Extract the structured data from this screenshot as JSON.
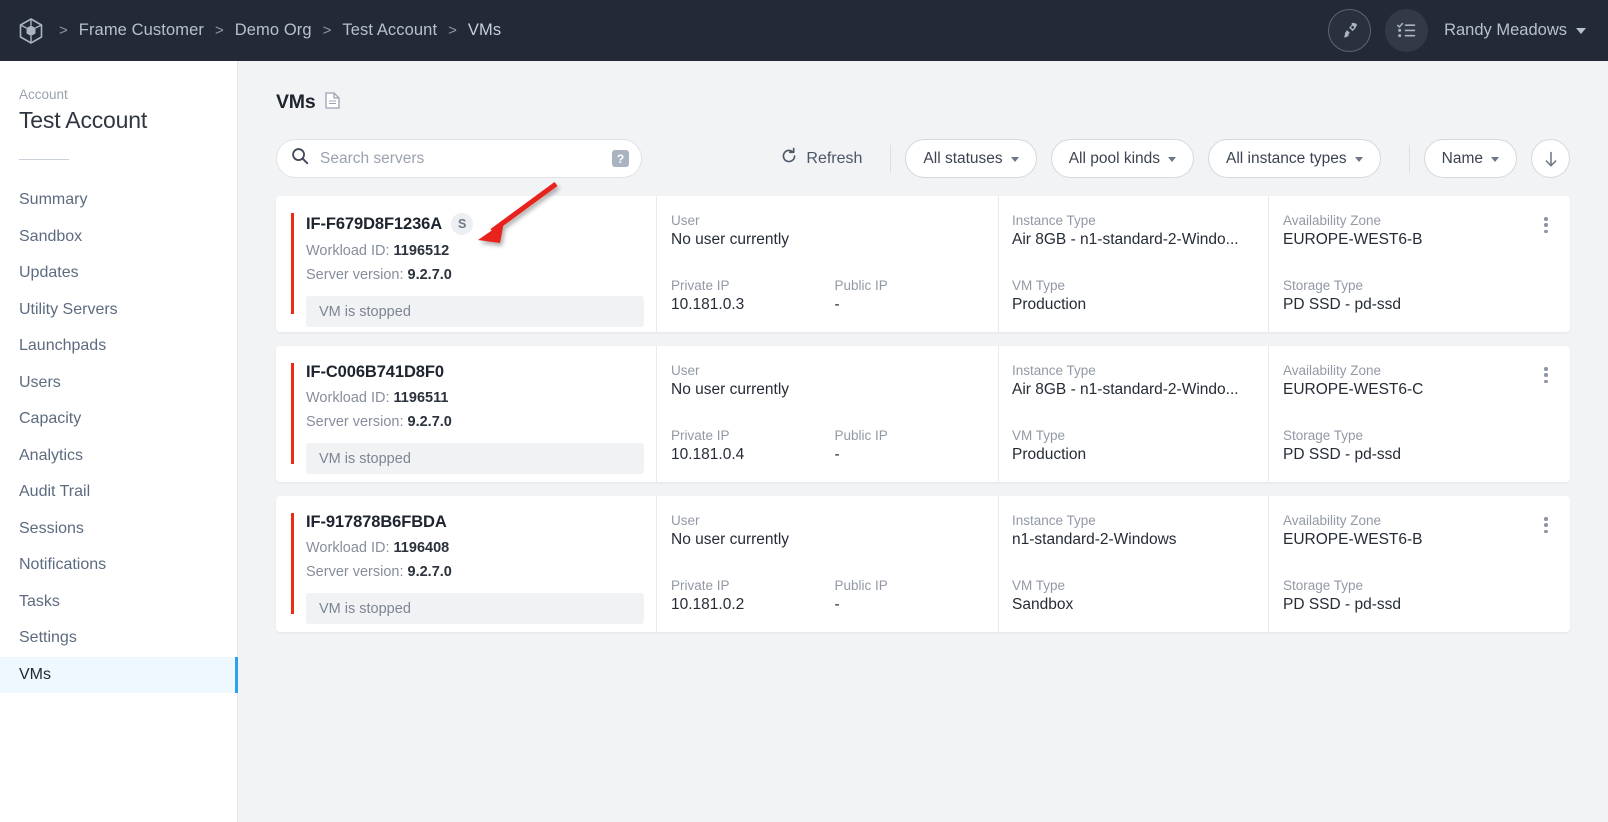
{
  "topbar": {
    "logo_icon": "cube-icon",
    "breadcrumbs": [
      "Frame Customer",
      "Demo Org",
      "Test Account",
      "VMs"
    ],
    "separator": ">",
    "rocket_icon": "rocket-icon",
    "tasks_icon": "checklist-icon",
    "user_name": "Randy Meadows"
  },
  "sidebar": {
    "section_label": "Account",
    "account_name": "Test Account",
    "items": [
      {
        "label": "Summary",
        "active": false
      },
      {
        "label": "Sandbox",
        "active": false
      },
      {
        "label": "Updates",
        "active": false
      },
      {
        "label": "Utility Servers",
        "active": false
      },
      {
        "label": "Launchpads",
        "active": false
      },
      {
        "label": "Users",
        "active": false
      },
      {
        "label": "Capacity",
        "active": false
      },
      {
        "label": "Analytics",
        "active": false
      },
      {
        "label": "Audit Trail",
        "active": false
      },
      {
        "label": "Sessions",
        "active": false
      },
      {
        "label": "Notifications",
        "active": false
      },
      {
        "label": "Tasks",
        "active": false
      },
      {
        "label": "Settings",
        "active": false
      },
      {
        "label": "VMs",
        "active": true
      }
    ]
  },
  "main": {
    "page_title": "VMs",
    "page_title_icon": "document-icon",
    "search": {
      "icon": "search-icon",
      "placeholder": "Search servers",
      "value": "",
      "help_badge": "?"
    },
    "refresh_label": "Refresh",
    "refresh_icon": "refresh-icon",
    "filters": [
      {
        "label": "All statuses"
      },
      {
        "label": "All pool kinds"
      },
      {
        "label": "All instance types"
      }
    ],
    "sort": {
      "label": "Name"
    },
    "sort_direction_icon": "arrow-down-icon",
    "field_labels": {
      "workload_id": "Workload ID:",
      "server_version": "Server version:",
      "user": "User",
      "private_ip": "Private IP",
      "public_ip": "Public IP",
      "instance_type": "Instance Type",
      "vm_type": "VM Type",
      "availability_zone": "Availability Zone",
      "storage_type": "Storage Type"
    },
    "cards": [
      {
        "name": "IF-F679D8F1236A",
        "badge": "S",
        "has_badge": true,
        "workload_id": "1196512",
        "server_version": "9.2.7.0",
        "status": "VM is stopped",
        "user": "No user currently",
        "private_ip": "10.181.0.3",
        "public_ip": "-",
        "instance_type": "Air 8GB - n1-standard-2-Windo...",
        "vm_type": "Production",
        "availability_zone": "EUROPE-WEST6-B",
        "storage_type": "PD SSD - pd-ssd"
      },
      {
        "name": "IF-C006B741D8F0",
        "badge": "",
        "has_badge": false,
        "workload_id": "1196511",
        "server_version": "9.2.7.0",
        "status": "VM is stopped",
        "user": "No user currently",
        "private_ip": "10.181.0.4",
        "public_ip": "-",
        "instance_type": "Air 8GB - n1-standard-2-Windo...",
        "vm_type": "Production",
        "availability_zone": "EUROPE-WEST6-C",
        "storage_type": "PD SSD - pd-ssd"
      },
      {
        "name": "IF-917878B6FBDA",
        "badge": "",
        "has_badge": false,
        "workload_id": "1196408",
        "server_version": "9.2.7.0",
        "status": "VM is stopped",
        "user": "No user currently",
        "private_ip": "10.181.0.2",
        "public_ip": "-",
        "instance_type": "n1-standard-2-Windows",
        "vm_type": "Sandbox",
        "availability_zone": "EUROPE-WEST6-B",
        "storage_type": "PD SSD - pd-ssd"
      }
    ]
  },
  "annotation": {
    "type": "arrow",
    "color": "#e8231a",
    "points_to": "s-badge-on-first-card"
  },
  "colors": {
    "topbar_bg": "#242a35",
    "accent_red": "#ee2b14",
    "active_nav": "#29a3f0",
    "page_bg": "#f1f3f5"
  }
}
